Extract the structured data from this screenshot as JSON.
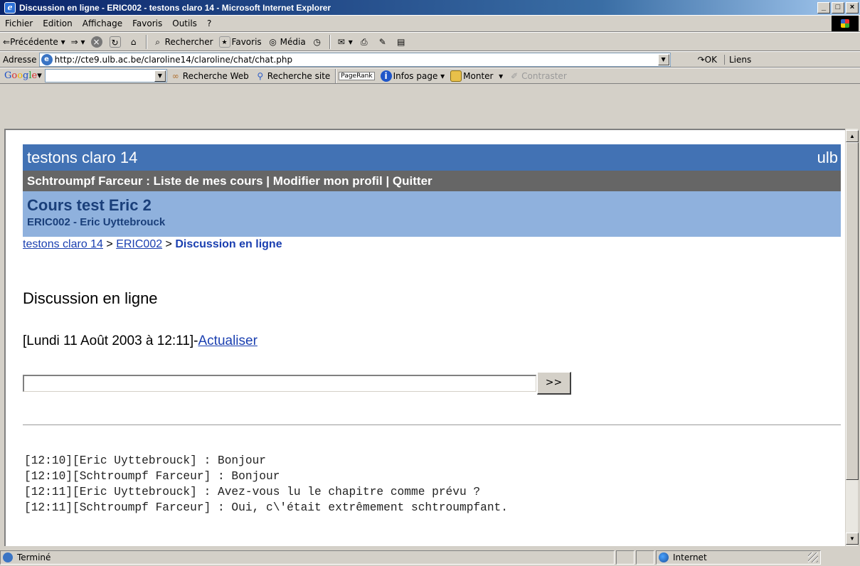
{
  "window": {
    "title": "Discussion en ligne - ERIC002 - testons claro 14 - Microsoft Internet Explorer",
    "minimize": "_",
    "maximize": "□",
    "close": "×"
  },
  "menu": [
    "Fichier",
    "Edition",
    "Affichage",
    "Favoris",
    "Outils",
    "?"
  ],
  "toolbar": {
    "back": "Précédente",
    "search": "Rechercher",
    "favorites": "Favoris",
    "media": "Média"
  },
  "address": {
    "label": "Adresse",
    "url": "http://cte9.ulb.ac.be/claroline14/claroline/chat/chat.php",
    "go": "OK",
    "links": "Liens"
  },
  "google_bar": {
    "logo": [
      "G",
      "o",
      "o",
      "g",
      "l",
      "e"
    ],
    "web_search": "Recherche Web",
    "site_search": "Recherche site",
    "pagerank": "PageRank",
    "page_info": "Infos page",
    "up": "Monter",
    "contrast": "Contraster"
  },
  "site": {
    "name": "testons claro 14",
    "institution": "ulb"
  },
  "user_bar": {
    "text": "Schtroumpf Farceur : Liste de mes cours | Modifier mon profil | Quitter"
  },
  "course": {
    "title": "Cours test Eric 2",
    "subtitle": "ERIC002 - Eric Uyttebrouck"
  },
  "breadcrumb": {
    "home": "testons claro 14",
    "course": "ERIC002",
    "current": "Discussion en ligne",
    "sep": " > "
  },
  "page": {
    "title": "Discussion en ligne",
    "datetime": "[Lundi 11 Août 2003 à 12:11]-",
    "refresh": "Actualiser",
    "send_label": ">>",
    "input_value": ""
  },
  "messages": [
    "[12:10][Eric Uyttebrouck] : Bonjour",
    "[12:10][Schtroumpf Farceur] : Bonjour",
    "[12:11][Eric Uyttebrouck] : Avez-vous lu le chapitre comme prévu ?",
    "[12:11][Schtroumpf Farceur] : Oui, c\\'était extrêmement schtroumpfant."
  ],
  "status": {
    "text": "Terminé",
    "zone": "Internet"
  },
  "colors": {
    "banner": "#4272b4",
    "user_bar": "#666666",
    "course_bar": "#8fb1dd",
    "link": "#1a3fb0"
  }
}
